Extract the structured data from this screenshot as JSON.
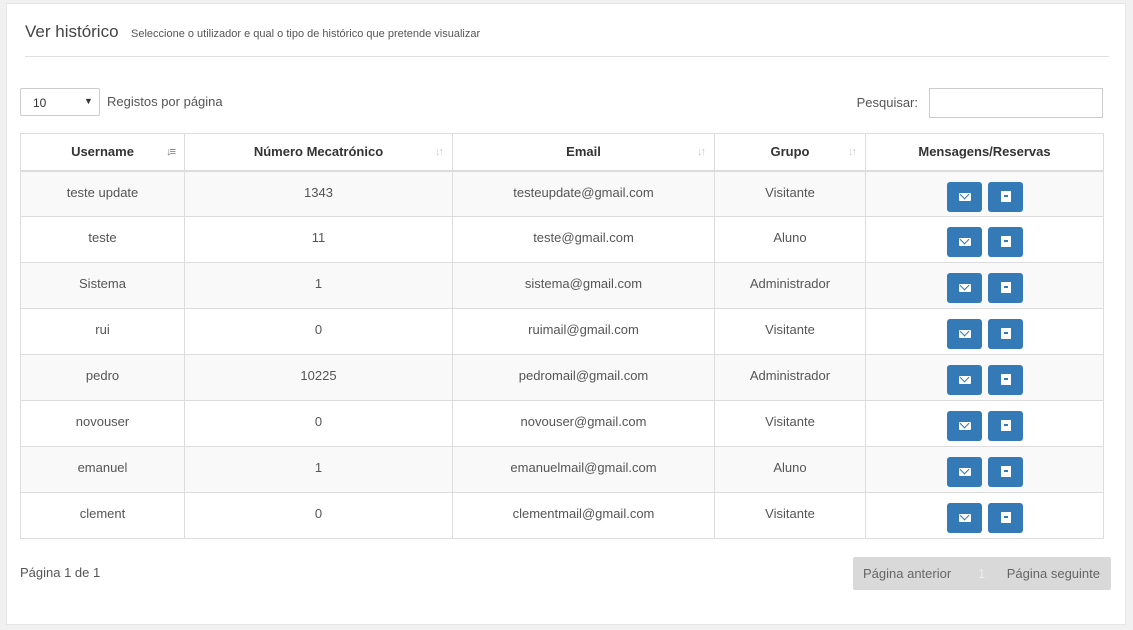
{
  "header": {
    "title": "Ver histórico",
    "subtitle": "Seleccione o utilizador e qual o tipo de histórico que pretende visualizar"
  },
  "controls": {
    "page_length": "10",
    "page_length_label": "Registos por página",
    "search_label": "Pesquisar:",
    "search_value": ""
  },
  "table": {
    "columns": [
      "Username",
      "Número Mecatrónico",
      "Email",
      "Grupo",
      "Mensagens/Reservas"
    ],
    "rows": [
      {
        "username": "teste update",
        "numero": "1343",
        "email": "testeupdate@gmail.com",
        "grupo": "Visitante"
      },
      {
        "username": "teste",
        "numero": "11",
        "email": "teste@gmail.com",
        "grupo": "Aluno"
      },
      {
        "username": "Sistema",
        "numero": "1",
        "email": "sistema@gmail.com",
        "grupo": "Administrador"
      },
      {
        "username": "rui",
        "numero": "0",
        "email": "ruimail@gmail.com",
        "grupo": "Visitante"
      },
      {
        "username": "pedro",
        "numero": "10225",
        "email": "pedromail@gmail.com",
        "grupo": "Administrador"
      },
      {
        "username": "novouser",
        "numero": "0",
        "email": "novouser@gmail.com",
        "grupo": "Visitante"
      },
      {
        "username": "emanuel",
        "numero": "1",
        "email": "emanuelmail@gmail.com",
        "grupo": "Aluno"
      },
      {
        "username": "clement",
        "numero": "0",
        "email": "clementmail@gmail.com",
        "grupo": "Visitante"
      }
    ]
  },
  "footer": {
    "info": "Página 1 de 1",
    "prev_label": "Página anterior",
    "current_page": "1",
    "next_label": "Página seguinte"
  },
  "colors": {
    "primary_button": "#337ab7",
    "pagination_bg": "#d9d9d9"
  },
  "icons": {
    "messages": "envelope-icon",
    "reservations": "archive-box-icon"
  }
}
